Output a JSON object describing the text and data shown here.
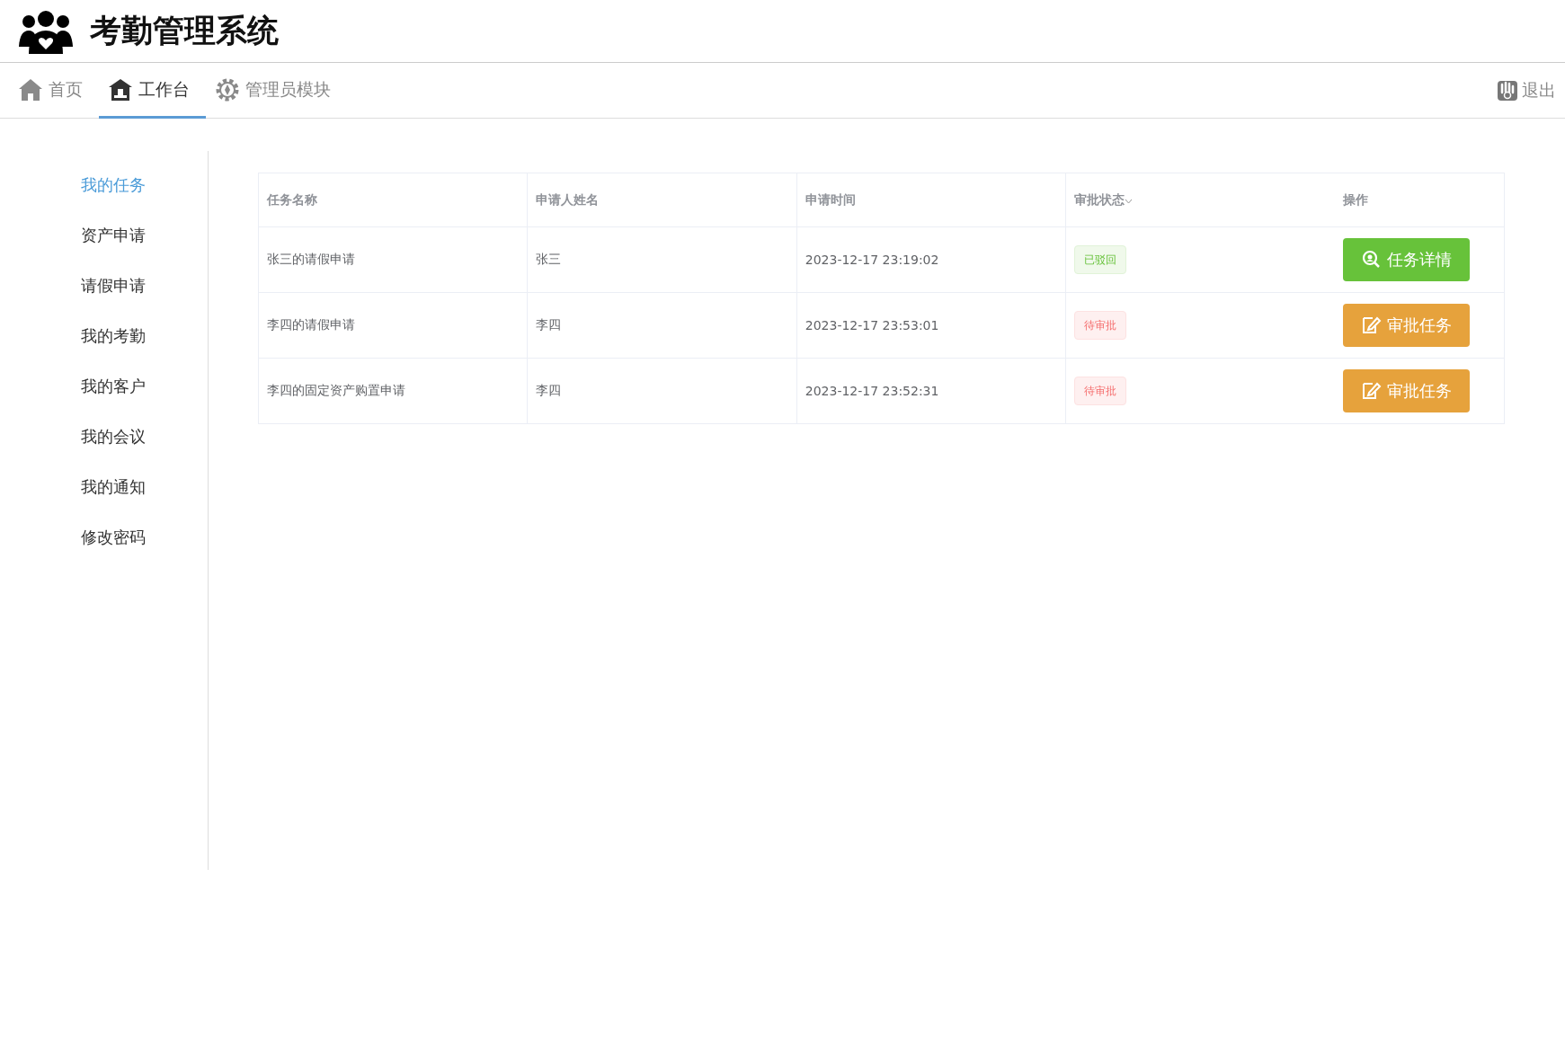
{
  "header": {
    "title": "考勤管理系统"
  },
  "nav": {
    "tabs": [
      {
        "label": "首页",
        "kind": "home",
        "selected": false
      },
      {
        "label": "工作台",
        "kind": "desk",
        "selected": true
      },
      {
        "label": "管理员模块",
        "kind": "gear",
        "selected": false
      }
    ],
    "logout": "退出"
  },
  "sidebar": {
    "items": [
      {
        "label": "我的任务",
        "selected": true
      },
      {
        "label": "资产申请",
        "selected": false
      },
      {
        "label": "请假申请",
        "selected": false
      },
      {
        "label": "我的考勤",
        "selected": false
      },
      {
        "label": "我的客户",
        "selected": false
      },
      {
        "label": "我的会议",
        "selected": false
      },
      {
        "label": "我的通知",
        "selected": false
      },
      {
        "label": "修改密码",
        "selected": false
      }
    ]
  },
  "table": {
    "columns": [
      "任务名称",
      "申请人姓名",
      "申请时间",
      "审批状态",
      "操作"
    ],
    "rows": [
      {
        "task": "张三的请假申请",
        "applicant": "张三",
        "time": "2023-12-17 23:19:02",
        "status": {
          "label": "已驳回",
          "kind": "rejected"
        },
        "action": {
          "label": "任务详情",
          "kind": "detail"
        }
      },
      {
        "task": "李四的请假申请",
        "applicant": "李四",
        "time": "2023-12-17 23:53:01",
        "status": {
          "label": "待审批",
          "kind": "pending"
        },
        "action": {
          "label": "审批任务",
          "kind": "approve"
        }
      },
      {
        "task": "李四的固定资产购置申请",
        "applicant": "李四",
        "time": "2023-12-17 23:52:31",
        "status": {
          "label": "待审批",
          "kind": "pending"
        },
        "action": {
          "label": "审批任务",
          "kind": "approve"
        }
      }
    ]
  }
}
